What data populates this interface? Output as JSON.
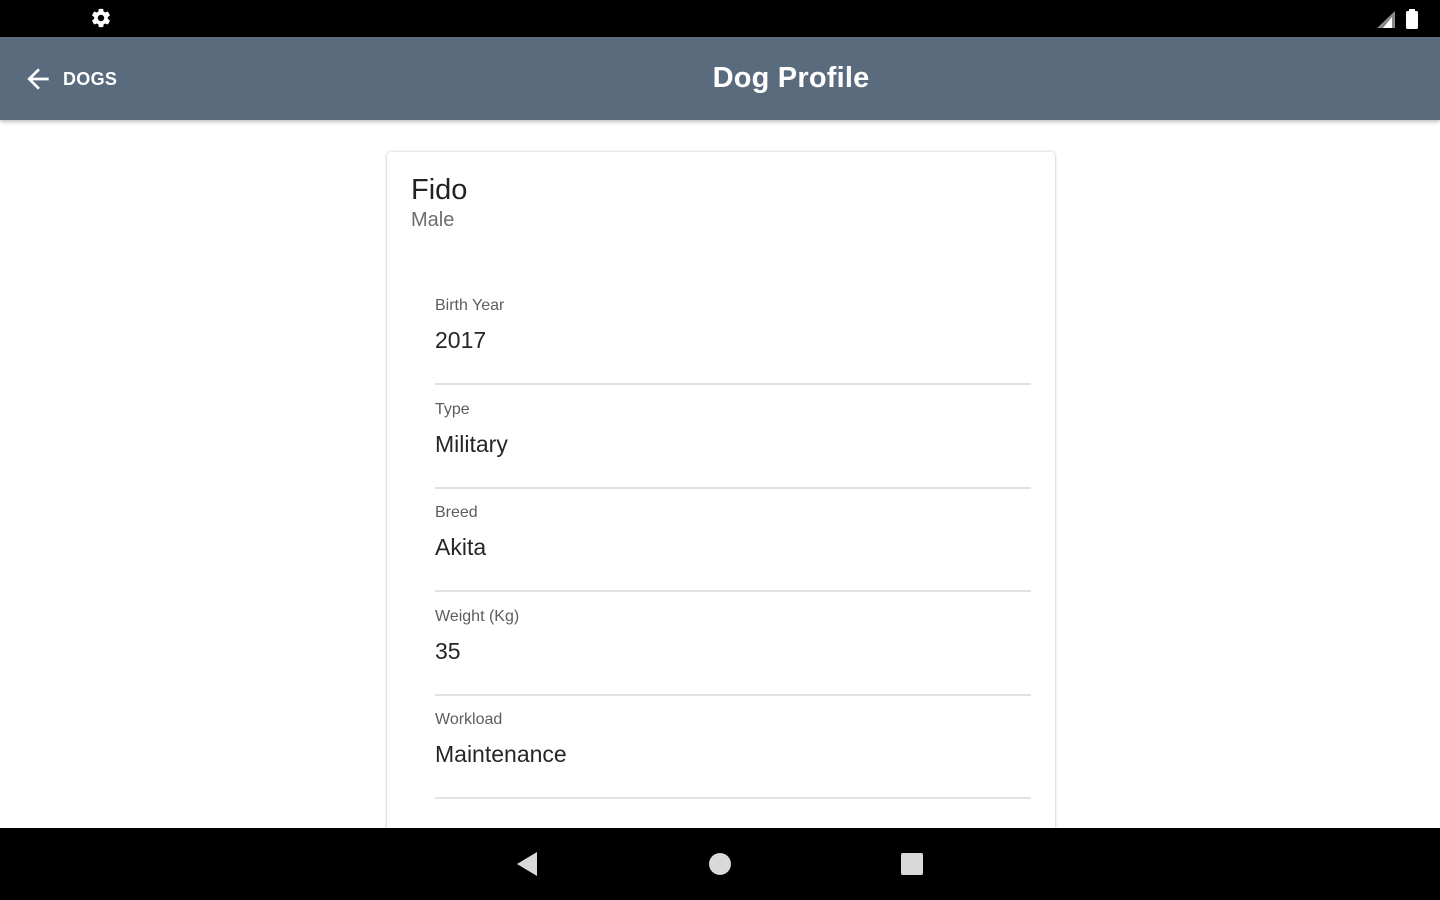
{
  "status_bar": {
    "left_icon": "gear-icon",
    "right_icons": [
      "signal-icon",
      "battery-icon"
    ]
  },
  "app_bar": {
    "back_label": "DOGS",
    "title": "Dog Profile",
    "background": "#5a6b7e"
  },
  "profile": {
    "name": "Fido",
    "sex": "Male",
    "fields": [
      {
        "label": "Birth Year",
        "value": "2017"
      },
      {
        "label": "Type",
        "value": "Military"
      },
      {
        "label": "Breed",
        "value": "Akita"
      },
      {
        "label": "Weight (Kg)",
        "value": "35"
      },
      {
        "label": "Workload",
        "value": "Maintenance"
      }
    ]
  },
  "nav_bar": {
    "buttons": [
      "back-triangle-icon",
      "home-circle-icon",
      "overview-square-icon"
    ]
  }
}
